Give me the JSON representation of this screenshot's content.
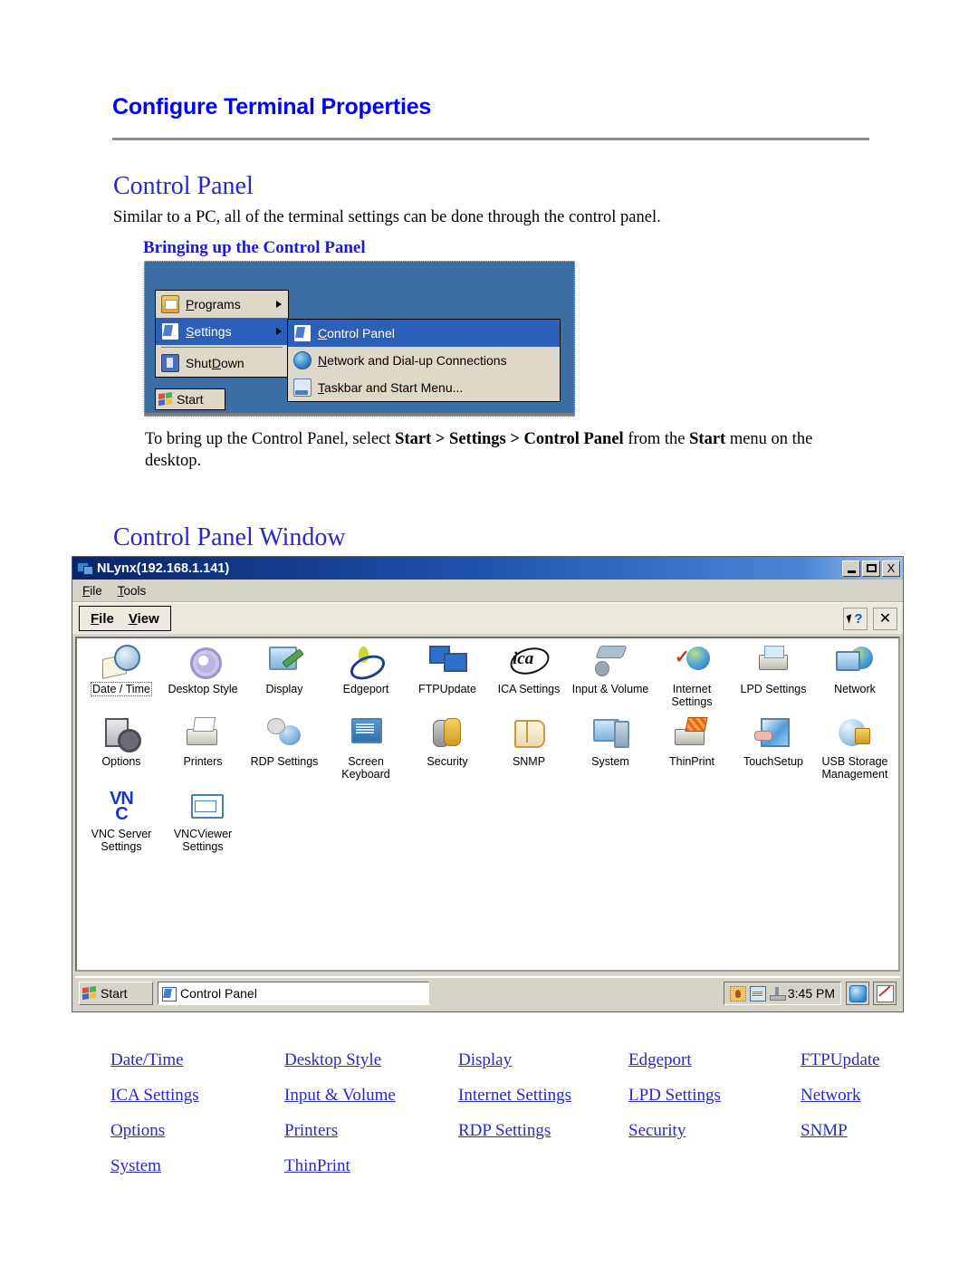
{
  "document": {
    "title": "Configure Terminal Properties",
    "section_control_panel": "Control Panel",
    "intro_paragraph": "Similar to a PC, all of the terminal settings can be done through the control panel.",
    "subheading_bringing_up": "Bringing up the Control Panel",
    "instruction_prefix": "To bring up the Control Panel, select ",
    "instruction_start": "Start",
    "instruction_gt1": " > ",
    "instruction_settings": "Settings",
    "instruction_gt2": " > ",
    "instruction_control_panel": "Control Panel",
    "instruction_mid": " from the ",
    "instruction_start2": "Start",
    "instruction_suffix": " menu on the desktop.",
    "section_control_panel_window": "Control Panel Window"
  },
  "start_menu": {
    "items": [
      {
        "label": "Programs",
        "accel": "P",
        "icon": "folder-programs-icon",
        "has_submenu": true,
        "selected": false
      },
      {
        "label": "Settings",
        "accel": "S",
        "icon": "settings-icon",
        "has_submenu": true,
        "selected": true
      },
      {
        "label": "ShutDown",
        "accel": "D",
        "icon": "shutdown-icon",
        "has_submenu": false,
        "selected": false
      }
    ],
    "submenu": [
      {
        "label": "Control Panel",
        "accel": "C",
        "icon": "control-panel-icon",
        "selected": true
      },
      {
        "label": "Network and Dial-up Connections",
        "accel": "N",
        "icon": "globe-icon",
        "selected": false
      },
      {
        "label": "Taskbar and Start Menu...",
        "accel": "T",
        "icon": "taskbar-icon",
        "selected": false
      }
    ],
    "start_button": "Start"
  },
  "control_panel_window": {
    "title": "NLynx(192.168.1.141)",
    "window_buttons": {
      "minimize": "minimize",
      "maximize": "maximize",
      "close": "X"
    },
    "menu_bar": [
      {
        "label": "File",
        "accel": "F"
      },
      {
        "label": "Tools",
        "accel": "T"
      }
    ],
    "toolbar": [
      {
        "label": "File",
        "accel": "F"
      },
      {
        "label": "View",
        "accel": "V"
      }
    ],
    "toolbar_right": [
      {
        "name": "context-help-button",
        "glyph": "?"
      },
      {
        "name": "close-button",
        "glyph": "✕"
      }
    ],
    "icons": [
      {
        "label": "Date / Time",
        "icon": "date-time-icon",
        "selected": true,
        "art": "g-clock"
      },
      {
        "label": "Desktop Style",
        "icon": "desktop-style-icon",
        "selected": false,
        "art": "g-gear"
      },
      {
        "label": "Display",
        "icon": "display-icon",
        "selected": false,
        "art": "g-display"
      },
      {
        "label": "Edgeport",
        "icon": "edgeport-icon",
        "selected": false,
        "art": "g-edge"
      },
      {
        "label": "FTPUpdate",
        "icon": "ftpupdate-icon",
        "selected": false,
        "art": "g-ftp"
      },
      {
        "label": "ICA Settings",
        "icon": "ica-settings-icon",
        "selected": false,
        "art": "g-ica"
      },
      {
        "label": "Input & Volume",
        "icon": "input-volume-icon",
        "selected": false,
        "art": "g-input"
      },
      {
        "label": "Internet Settings",
        "icon": "internet-settings-icon",
        "selected": false,
        "art": "g-internet"
      },
      {
        "label": "LPD Settings",
        "icon": "lpd-settings-icon",
        "selected": false,
        "art": "g-lpd"
      },
      {
        "label": "Network",
        "icon": "network-icon",
        "selected": false,
        "art": "g-network"
      },
      {
        "label": "Options",
        "icon": "options-icon",
        "selected": false,
        "art": "g-options"
      },
      {
        "label": "Printers",
        "icon": "printers-icon",
        "selected": false,
        "art": "g-printers"
      },
      {
        "label": "RDP Settings",
        "icon": "rdp-settings-icon",
        "selected": false,
        "art": "g-rdp"
      },
      {
        "label": "Screen Keyboard",
        "icon": "screen-keyboard-icon",
        "selected": false,
        "art": "g-screenkb"
      },
      {
        "label": "Security",
        "icon": "security-icon",
        "selected": false,
        "art": "g-security"
      },
      {
        "label": "SNMP",
        "icon": "snmp-icon",
        "selected": false,
        "art": "g-snmp"
      },
      {
        "label": "System",
        "icon": "system-icon",
        "selected": false,
        "art": "g-system"
      },
      {
        "label": "ThinPrint",
        "icon": "thinprint-icon",
        "selected": false,
        "art": "g-thinprint"
      },
      {
        "label": "TouchSetup",
        "icon": "touchsetup-icon",
        "selected": false,
        "art": "g-touch"
      },
      {
        "label": "USB Storage Management",
        "icon": "usb-storage-management-icon",
        "selected": false,
        "art": "g-usb"
      },
      {
        "label": "VNC Server Settings",
        "icon": "vnc-server-settings-icon",
        "selected": false,
        "art": "g-vnc"
      },
      {
        "label": "VNCViewer Settings",
        "icon": "vncviewer-settings-icon",
        "selected": false,
        "art": "g-vncviewer"
      }
    ],
    "taskbar": {
      "start_button": "Start",
      "task_button": "Control Panel",
      "clock": "3:45 PM",
      "tray_icons": [
        "user-icon",
        "keyboard-icon",
        "connection-icon"
      ],
      "tray_buttons": [
        "ie-browser-icon",
        "edit-pen-icon"
      ]
    }
  },
  "links": {
    "rows": [
      [
        "Date/Time",
        "Desktop Style",
        "Display",
        "Edgeport",
        "FTPUpdate"
      ],
      [
        "ICA Settings",
        "Input & Volume",
        "Internet Settings",
        "LPD Settings",
        "Network"
      ],
      [
        "Options",
        "Printers",
        "RDP Settings",
        "Security",
        "SNMP"
      ],
      [
        "System",
        "ThinPrint",
        "",
        "",
        ""
      ]
    ]
  },
  "colors": {
    "heading_blue": "#0000ff",
    "subheading_blue": "#2a28c8",
    "link_blue": "#2a28c8",
    "titlebar_blue": "#0a246a",
    "desktop_blue": "#3b6ea5"
  }
}
